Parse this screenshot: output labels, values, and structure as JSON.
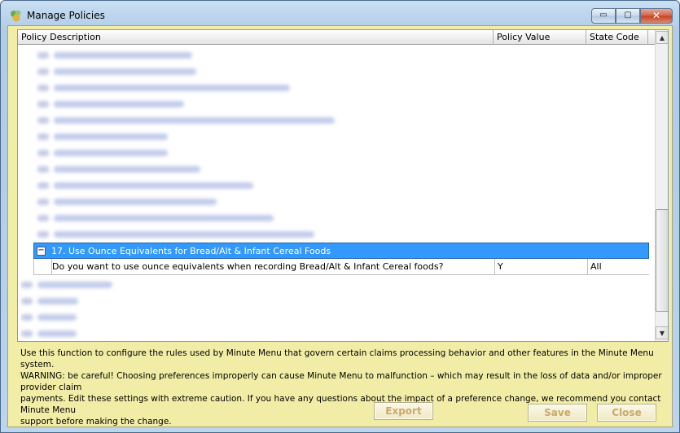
{
  "window": {
    "title": "Manage Policies",
    "controls": {
      "minimize": "▭",
      "maximize": "▢",
      "close": "✕"
    }
  },
  "grid": {
    "columns": [
      "Policy Description",
      "Policy Value",
      "State Code"
    ],
    "expanded_group": {
      "label": "17. Use Ounce Equivalents for Bread/Alt & Infant Cereal Foods",
      "collapse_symbol": "−"
    },
    "detail_row": {
      "description": "Do you want to use ounce equivalents when recording Bread/Alt & Infant Cereal foods?",
      "value": "Y",
      "state_code": "All"
    },
    "scroll": {
      "up": "▲",
      "down": "▼"
    }
  },
  "info": {
    "lines": [
      "Use this function to configure the rules used by Minute Menu that govern certain claims processing behavior and other features in the Minute Menu system.",
      "WARNING:  be careful!  Choosing preferences improperly can cause Minute Menu to malfunction – which may result in the loss of data and/or improper provider claim",
      "payments.  Edit these settings with extreme caution.  If you have any questions about the impact of a preference change, we recommend you contact Minute Menu",
      "support before making the change."
    ]
  },
  "buttons": {
    "export": "Export",
    "save": "Save",
    "close": "Close"
  },
  "colors": {
    "selection": "#3399ff",
    "panel": "#f2eda6",
    "disabled_text": "#c9a96b"
  }
}
